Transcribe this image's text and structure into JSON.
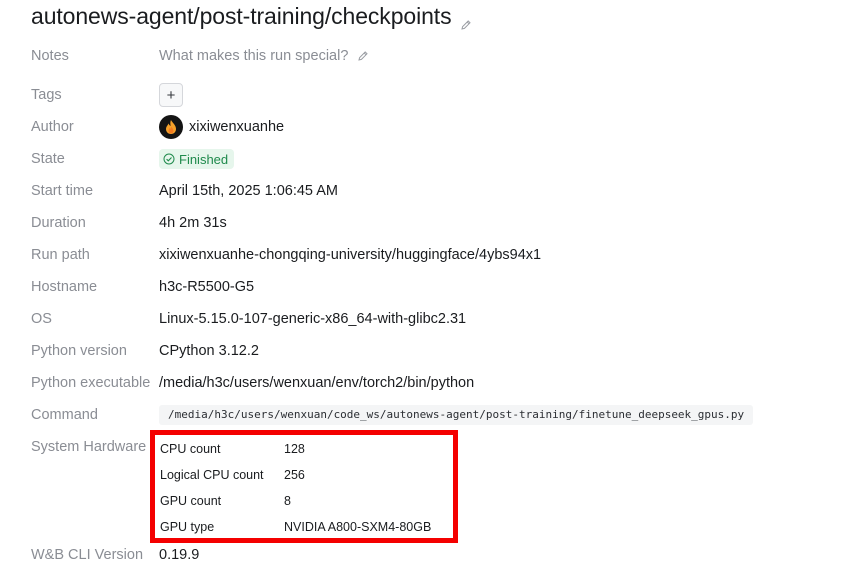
{
  "title": "autonews-agent/post-training/checkpoints",
  "notes": {
    "label": "Notes",
    "placeholder": "What makes this run special?"
  },
  "tags": {
    "label": "Tags",
    "add_label": "+"
  },
  "author": {
    "label": "Author",
    "name": "xixiwenxuanhe"
  },
  "state": {
    "label": "State",
    "value": "Finished",
    "color": "#1f8a4c"
  },
  "start_time": {
    "label": "Start time",
    "value": "April 15th, 2025 1:06:45 AM"
  },
  "duration": {
    "label": "Duration",
    "value": "4h 2m 31s"
  },
  "run_path": {
    "label": "Run path",
    "value": "xixiwenxuanhe-chongqing-university/huggingface/4ybs94x1"
  },
  "hostname": {
    "label": "Hostname",
    "value": "h3c-R5500-G5"
  },
  "os": {
    "label": "OS",
    "value": "Linux-5.15.0-107-generic-x86_64-with-glibc2.31"
  },
  "python_version": {
    "label": "Python version",
    "value": "CPython 3.12.2"
  },
  "python_executable": {
    "label": "Python executable",
    "value": "/media/h3c/users/wenxuan/env/torch2/bin/python"
  },
  "command": {
    "label": "Command",
    "value": "/media/h3c/users/wenxuan/code_ws/autonews-agent/post-training/finetune_deepseek_gpus.py"
  },
  "system_hardware": {
    "label": "System Hardware",
    "highlight_color": "#f40000",
    "rows": [
      {
        "key": "CPU count",
        "value": "128"
      },
      {
        "key": "Logical CPU count",
        "value": "256"
      },
      {
        "key": "GPU count",
        "value": "8"
      },
      {
        "key": "GPU type",
        "value": "NVIDIA A800-SXM4-80GB"
      }
    ]
  },
  "cli_version": {
    "label": "W&B CLI Version",
    "value": "0.19.9"
  },
  "icons": {
    "title_edit": "pencil-icon",
    "notes_edit": "pencil-icon",
    "avatar": "flame-icon",
    "state": "check-circle-icon"
  }
}
